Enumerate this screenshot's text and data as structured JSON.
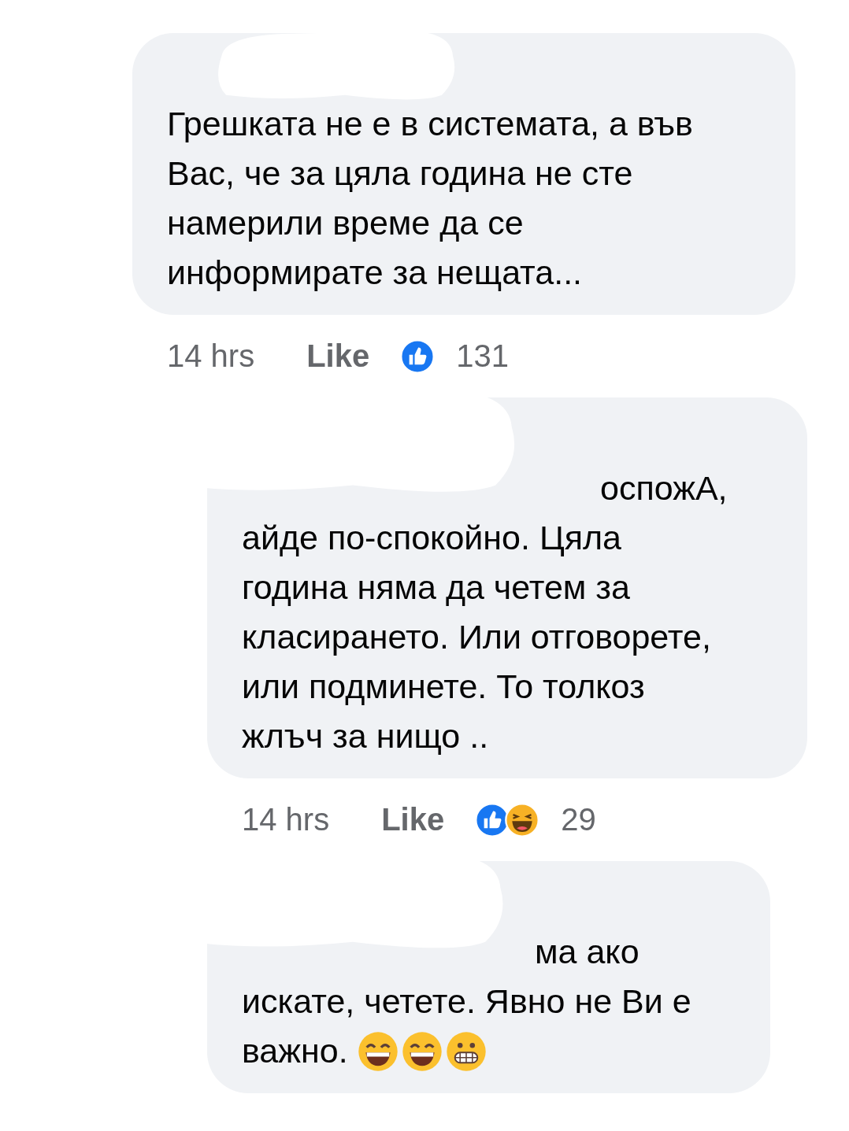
{
  "comments": [
    {
      "kind": "top",
      "redacted": true,
      "lines": [
        "Грешката не е в системата, а във",
        "Вас, че за цяла година не сте",
        "намерили време да се",
        "информирате за нещата..."
      ],
      "time": "14 hrs",
      "like": "Like",
      "reactions": [
        {
          "kind": "like"
        }
      ],
      "count": "131"
    },
    {
      "kind": "reply",
      "redacted": true,
      "lines": [
        "оспожА,",
        "айде по-спокойно. Цяла",
        "година няма да четем за",
        "класирането. Или отговорете,",
        "или подминете. То толкоз",
        "жлъч за нищо .."
      ],
      "time": "14 hrs",
      "like": "Like",
      "reactions": [
        {
          "kind": "like"
        },
        {
          "kind": "haha"
        }
      ],
      "count": "29"
    },
    {
      "kind": "reply",
      "redacted": true,
      "lines": [
        "ма ако",
        "искате, четете. Явно не Ви е",
        "важно."
      ],
      "emojis": [
        {
          "kind": "grin"
        },
        {
          "kind": "grin"
        },
        {
          "kind": "grimace"
        }
      ]
    }
  ]
}
